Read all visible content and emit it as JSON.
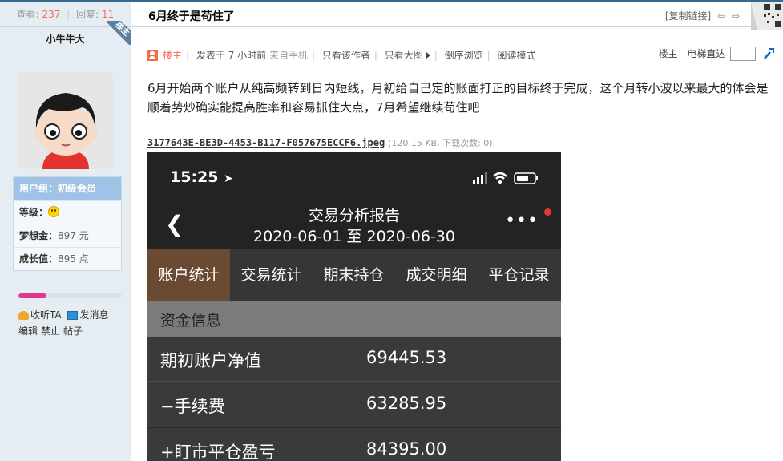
{
  "sidebar": {
    "views_label": "查看:",
    "views_count": "237",
    "replies_label": "回复:",
    "replies_count": "11",
    "author_name": "小牛牛大",
    "badge": "楼主",
    "user_group_label": "用户组：",
    "user_group": "初级会员",
    "level_label": "等级：",
    "dream_gold_label": "梦想金：",
    "dream_gold": "897 元",
    "growth_label": "成长值：",
    "growth": "895 点",
    "growth_progress": 0.27,
    "follow_label": "收听TA",
    "message_label": "发消息",
    "edit_label": "编辑",
    "ban_label": "禁止",
    "posts_label": "帖子"
  },
  "post": {
    "title": "6月终于是苟住了",
    "copy_link": "[复制链接]",
    "meta": {
      "author_role": "楼主",
      "posted": "发表于 7 小时前",
      "from": "来自手机",
      "only_author": "只看该作者",
      "only_big_img": "只看大图",
      "reverse": "倒序浏览",
      "read_mode": "阅读模式",
      "floor": "楼主",
      "jump": "电梯直达"
    },
    "body": "6月开始两个账户从纯高频转到日内短线，月初给自己定的账面打正的目标终于完成，这个月转小波以来最大的体会是顺着势炒确实能提高胜率和容易抓住大点，7月希望继续苟住吧",
    "attachment": {
      "filename": "3177643E-BE3D-4453-B117-F057675ECCF6.jpeg",
      "info": "(120.15 KB, 下载次数: 0)"
    }
  },
  "phone": {
    "time": "15:25",
    "title": "交易分析报告",
    "range": "2020-06-01 至 2020-06-30",
    "tabs": [
      "账户统计",
      "交易统计",
      "期末持仓",
      "成交明细",
      "平仓记录"
    ],
    "section": "资金信息",
    "rows": [
      {
        "label": "期初账户净值",
        "value": "69445.53"
      },
      {
        "label": "−手续费",
        "value": "63285.95"
      },
      {
        "label": "+盯市平仓盈亏",
        "value": "84395.00"
      }
    ]
  },
  "colors": {
    "accent": "#f26c4f",
    "sidebar_bg": "#e5edf2",
    "phone_tab_active": "#6b4a33"
  }
}
